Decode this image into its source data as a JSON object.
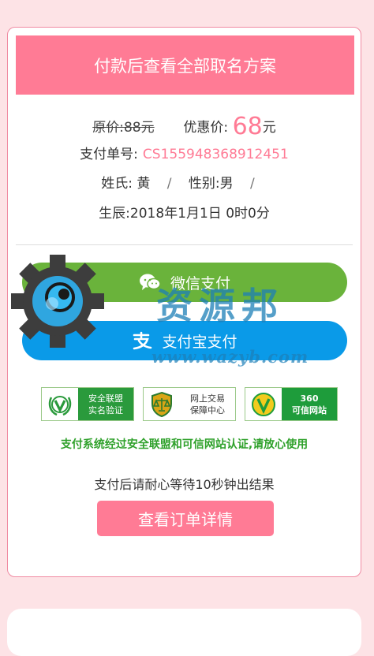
{
  "banner": {
    "title": "付款后查看全部取名方案"
  },
  "price": {
    "original_label": "原价:",
    "original_value": "88元",
    "discount_label": "优惠价:",
    "discount_value": "68",
    "discount_unit": "元"
  },
  "order": {
    "label": "支付单号:",
    "number": "CS155948368912451"
  },
  "person": {
    "surname_label": "姓氏:",
    "surname": "黄",
    "gender_label": "性别:",
    "gender": "男",
    "separator": "/",
    "birth_label": "生辰:",
    "birth": "2018年1月1日 0时0分"
  },
  "payment": {
    "wechat_label": "微信支付",
    "wechat_icon": "wechat-icon",
    "alipay_label": "支付宝支付",
    "alipay_icon": "alipay-icon",
    "wechat_color": "#6ab33b",
    "alipay_color": "#0a9ae8"
  },
  "badges": [
    {
      "line1": "安全联盟",
      "line2": "实名验证",
      "icon": "verified-v-laurel-icon"
    },
    {
      "line1": "网上交易",
      "line2": "保障中心",
      "icon": "scales-shield-icon"
    },
    {
      "line1": "360",
      "line2": "可信网站",
      "icon": "360-verified-v-icon"
    }
  ],
  "security_note": "支付系统经过安全联盟和可信网站认证,请放心使用",
  "wait_text": "支付后请耐心等待10秒钟出结果",
  "order_button": "查看订单详情",
  "watermark": {
    "text": "资源邦",
    "url": "www.wazyb.com",
    "icon": "gear-eye-logo-icon"
  },
  "colors": {
    "accent": "#ff7b95",
    "background": "#fde3e6",
    "trust_green": "#2fa12b"
  }
}
